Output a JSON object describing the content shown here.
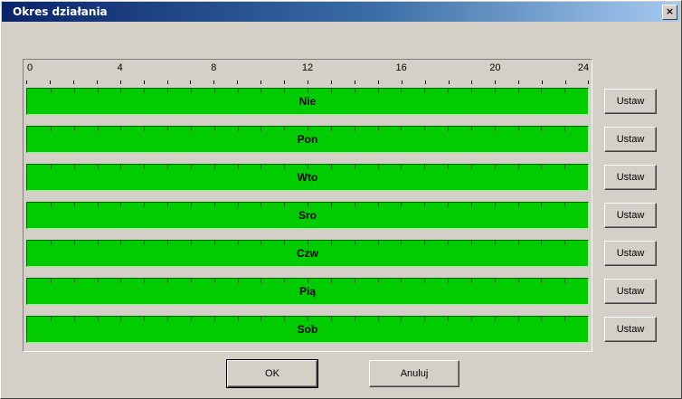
{
  "window": {
    "title": "Okres działania",
    "close_glyph": "×"
  },
  "ruler": {
    "hour_labels": [
      "0",
      "4",
      "8",
      "12",
      "16",
      "20",
      "24"
    ]
  },
  "days": [
    {
      "label": "Nie",
      "set_label": "Ustaw"
    },
    {
      "label": "Pon",
      "set_label": "Ustaw"
    },
    {
      "label": "Wto",
      "set_label": "Ustaw"
    },
    {
      "label": "Sro",
      "set_label": "Ustaw"
    },
    {
      "label": "Czw",
      "set_label": "Ustaw"
    },
    {
      "label": "Pią",
      "set_label": "Ustaw"
    },
    {
      "label": "Sob",
      "set_label": "Ustaw"
    }
  ],
  "buttons": {
    "ok_label": "OK",
    "cancel_label": "Anuluj"
  },
  "colors": {
    "active_period": "#00cc00",
    "titlebar": "#0a246a"
  }
}
